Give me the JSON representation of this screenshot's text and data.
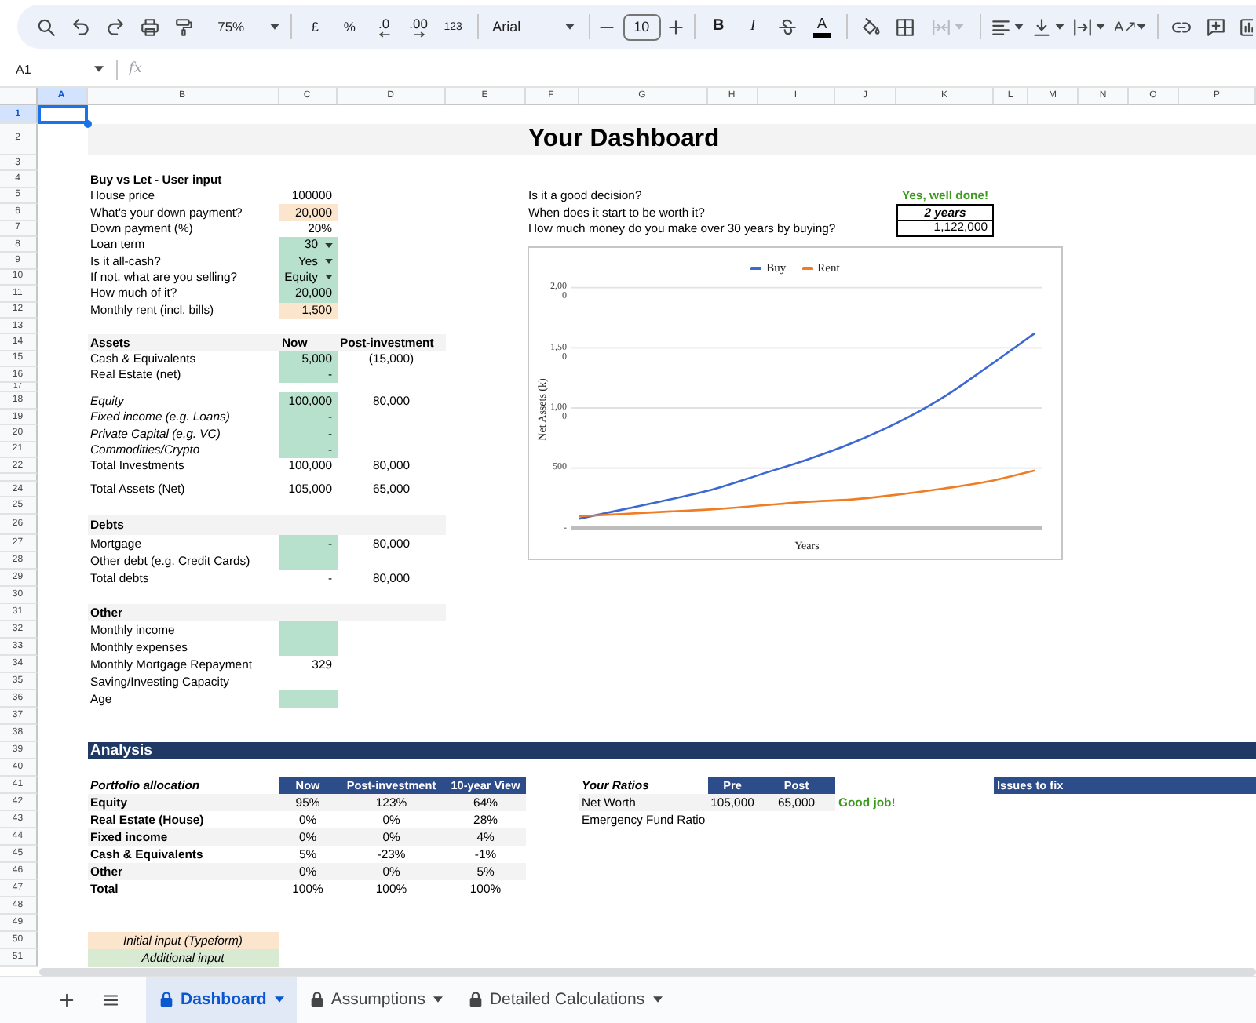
{
  "toolbar": {
    "zoom": "75%",
    "number_formats": [
      "£",
      "%",
      ".0",
      ".00",
      "123"
    ],
    "font": "Arial",
    "font_size": "10",
    "text_styles": [
      "B",
      "I"
    ],
    "text_color": "A",
    "merge_cells": {
      "disabled": true
    },
    "text_rotation": "A"
  },
  "formula_bar": {
    "cell_ref": "A1",
    "function_label": "fx"
  },
  "sheet": {
    "columns": [
      {
        "label": "A",
        "selected": true
      },
      {
        "label": "B",
        "selected": false
      },
      {
        "label": "C",
        "selected": false
      },
      {
        "label": "D",
        "selected": false
      },
      {
        "label": "E",
        "selected": false
      },
      {
        "label": "F",
        "selected": false
      },
      {
        "label": "G",
        "selected": false
      },
      {
        "label": "H",
        "selected": false
      },
      {
        "label": "I",
        "selected": false
      },
      {
        "label": "J",
        "selected": false
      },
      {
        "label": "K",
        "selected": false
      },
      {
        "label": "L",
        "selected": false
      },
      {
        "label": "M",
        "selected": false
      },
      {
        "label": "N",
        "selected": false
      },
      {
        "label": "O",
        "selected": false
      },
      {
        "label": "P",
        "selected": false
      }
    ],
    "rows": [
      {
        "label": "1",
        "selected": true
      },
      {
        "label": "2",
        "selected": false
      },
      {
        "label": "3",
        "selected": false
      },
      {
        "label": "4",
        "selected": false
      },
      {
        "label": "5",
        "selected": false
      },
      {
        "label": "6",
        "selected": false
      },
      {
        "label": "7",
        "selected": false
      },
      {
        "label": "8",
        "selected": false
      },
      {
        "label": "9",
        "selected": false
      },
      {
        "label": "10",
        "selected": false
      },
      {
        "label": "11",
        "selected": false
      },
      {
        "label": "12",
        "selected": false
      },
      {
        "label": "13",
        "selected": false
      },
      {
        "label": "14",
        "selected": false
      },
      {
        "label": "15",
        "selected": false
      },
      {
        "label": "16",
        "selected": false
      },
      {
        "label": "17",
        "selected": false
      },
      {
        "label": "18",
        "selected": false
      },
      {
        "label": "19",
        "selected": false
      },
      {
        "label": "20",
        "selected": false
      },
      {
        "label": "21",
        "selected": false
      },
      {
        "label": "22",
        "selected": false
      },
      {
        "selected": false
      },
      {
        "label": "24",
        "selected": false
      },
      {
        "label": "25",
        "selected": false
      },
      {
        "label": "26",
        "selected": false
      },
      {
        "label": "27",
        "selected": false
      },
      {
        "label": "28",
        "selected": false
      },
      {
        "label": "29",
        "selected": false
      },
      {
        "label": "30",
        "selected": false
      },
      {
        "label": "31",
        "selected": false
      },
      {
        "label": "32",
        "selected": false
      },
      {
        "label": "33",
        "selected": false
      },
      {
        "label": "34",
        "selected": false
      },
      {
        "label": "35",
        "selected": false
      },
      {
        "label": "36",
        "selected": false
      },
      {
        "label": "37",
        "selected": false
      },
      {
        "label": "38",
        "selected": false
      },
      {
        "label": "39",
        "selected": false
      },
      {
        "label": "40",
        "selected": false
      },
      {
        "label": "41",
        "selected": false
      },
      {
        "label": "42",
        "selected": false
      },
      {
        "label": "43",
        "selected": false
      },
      {
        "label": "44",
        "selected": false
      },
      {
        "label": "45",
        "selected": false
      },
      {
        "label": "46",
        "selected": false
      },
      {
        "label": "47",
        "selected": false
      },
      {
        "label": "48",
        "selected": false
      },
      {
        "label": "49",
        "selected": false
      },
      {
        "label": "50",
        "selected": false
      },
      {
        "label": "51",
        "selected": false
      }
    ]
  },
  "dashboard": {
    "title": "Your Dashboard"
  },
  "user_input": {
    "heading": "Buy vs Let - User input",
    "fields": [
      {
        "label": "House price",
        "value": "100000",
        "dropdown": false
      },
      {
        "label": "What's your down payment?",
        "value": "20,000",
        "color": "#fce5cd",
        "dropdown": false
      },
      {
        "label": "Down payment (%)",
        "value": "20%",
        "dropdown": false
      },
      {
        "label": "Loan term",
        "value": "30",
        "color": "#b7e1cd",
        "dropdown": true
      },
      {
        "label": "Is it all-cash?",
        "value": "Yes",
        "color": "#b7e1cd",
        "dropdown": true
      },
      {
        "label": "If not, what are you selling?",
        "value": "Equity",
        "color": "#b7e1cd",
        "dropdown": true
      },
      {
        "label": "How much of it?",
        "value": "20,000",
        "color": "#b7e1cd",
        "dropdown": false
      },
      {
        "label": "Monthly rent (incl. bills)",
        "value": "1,500",
        "color": "#fce5cd",
        "dropdown": false
      }
    ]
  },
  "questions": [
    {
      "label": "Is it a good decision?",
      "answer": "Yes, well done!",
      "kind": "verdict"
    },
    {
      "label": "When does it start to be worth it?",
      "answer": "2 years",
      "kind": "period"
    },
    {
      "label": "How much money do you make over 30 years by buying?",
      "answer": "1,122,000",
      "kind": "amount"
    }
  ],
  "chart": {
    "chart_data": {
      "type": "line",
      "xlabel": "Years",
      "ylabel": "Net Assets (k)",
      "categories": [
        null,
        null,
        null,
        null,
        null,
        null,
        null,
        null,
        null,
        null,
        null
      ],
      "series": [
        {
          "name": "Buy",
          "color": "#3b68d1",
          "values": [
            80,
            160,
            240,
            330,
            450,
            570,
            710,
            880,
            1090,
            1350,
            1620
          ]
        },
        {
          "name": "Rent",
          "color": "#f07c24",
          "values": [
            100,
            120,
            140,
            160,
            190,
            220,
            240,
            280,
            330,
            390,
            480
          ]
        }
      ],
      "ylim": [
        0,
        2000
      ],
      "yticks": [
        {
          "value": 0,
          "label": "-"
        },
        500,
        {
          "value": 1000,
          "label": "1,000"
        },
        {
          "value": 1500,
          "label": "1,500"
        },
        {
          "value": 2000,
          "label": "2,000"
        }
      ],
      "grid": true,
      "legend": "top"
    }
  },
  "assets": {
    "columns": [
      "Assets",
      "Now",
      "Post-investment"
    ],
    "groups": [
      {
        "rows": [
          {
            "label": "Cash & Equivalents",
            "now": "5,000",
            "post": "(15,000)",
            "color": "#b7e1cd",
            "kind": "item"
          },
          {
            "label": "Real Estate (net)",
            "now": "-",
            "color": "#b7e1cd",
            "kind": "item"
          }
        ]
      },
      {
        "rows": [
          {
            "label": "Equity",
            "now": "100,000",
            "post": "80,000",
            "color": "#b7e1cd",
            "kind": "subitem"
          },
          {
            "label": "Fixed income (e.g. Loans)",
            "now": "-",
            "color": "#b7e1cd",
            "kind": "subitem"
          },
          {
            "label": "Private Capital (e.g. VC)",
            "now": "-",
            "color": "#b7e1cd",
            "kind": "subitem"
          },
          {
            "label": "Commodities/Crypto",
            "now": "-",
            "color": "#b7e1cd",
            "kind": "subitem"
          },
          {
            "label": "Total Investments",
            "now": "100,000",
            "post": "80,000",
            "kind": "item"
          }
        ]
      },
      {
        "rows": [
          {
            "label": "Total Assets (Net)",
            "now": "105,000",
            "post": "65,000",
            "kind": "item"
          }
        ]
      }
    ]
  },
  "debts": {
    "title": "Debts",
    "rows": [
      {
        "label": "Mortgage",
        "now": "-",
        "post": "80,000",
        "color": "#b7e1cd"
      },
      {
        "label": "Other debt (e.g. Credit Cards)",
        "color": "#b7e1cd"
      },
      {
        "label": "Total debts",
        "now": "-",
        "post": "80,000"
      }
    ]
  },
  "other": {
    "title": "Other",
    "rows": [
      {
        "label": "Monthly income",
        "color": "#b7e1cd"
      },
      {
        "label": "Monthly expenses",
        "color": "#b7e1cd"
      },
      {
        "label": "Monthly Mortgage Repayment",
        "now": "329"
      },
      {
        "label": "Saving/Investing Capacity"
      },
      {
        "label": "Age",
        "color": "#b7e1cd"
      }
    ]
  },
  "analysis": {
    "title": "Analysis",
    "portfolio": {
      "title": "Portfolio allocation",
      "columns": [
        "Now",
        "Post-investment",
        "10-year View"
      ],
      "rows": [
        {
          "label": "Equity",
          "values": [
            "95%",
            "123%",
            "64%"
          ]
        },
        {
          "label": "Real Estate (House)",
          "values": [
            "0%",
            "0%",
            "28%"
          ]
        },
        {
          "label": "Fixed income",
          "values": [
            "0%",
            "0%",
            "4%"
          ]
        },
        {
          "label": "Cash & Equivalents",
          "values": [
            "5%",
            "-23%",
            "-1%"
          ]
        },
        {
          "label": "Other",
          "values": [
            "0%",
            "0%",
            "5%"
          ]
        },
        {
          "label": "Total",
          "values": [
            "100%",
            "100%",
            "100%"
          ]
        }
      ]
    },
    "ratios": {
      "title": "Your Ratios",
      "columns": [
        "Pre",
        "Post"
      ],
      "rows": [
        {
          "label": "Net Worth",
          "values": [
            "105,000",
            "65,000"
          ],
          "note": "Good job!"
        },
        {
          "label": "Emergency Fund Ratio"
        }
      ]
    },
    "issues": {
      "title": "Issues to fix"
    }
  },
  "legend": [
    {
      "label": "Initial input (Typeform)",
      "color": "#fce5cd"
    },
    {
      "label": "Additional input",
      "color": "#d9ead3"
    }
  ],
  "sheet_tabs": [
    {
      "label": "Dashboard",
      "selected": true,
      "locked": true
    },
    {
      "label": "Assumptions",
      "selected": false,
      "locked": true
    },
    {
      "label": "Detailed Calculations",
      "selected": false,
      "locked": true
    }
  ]
}
